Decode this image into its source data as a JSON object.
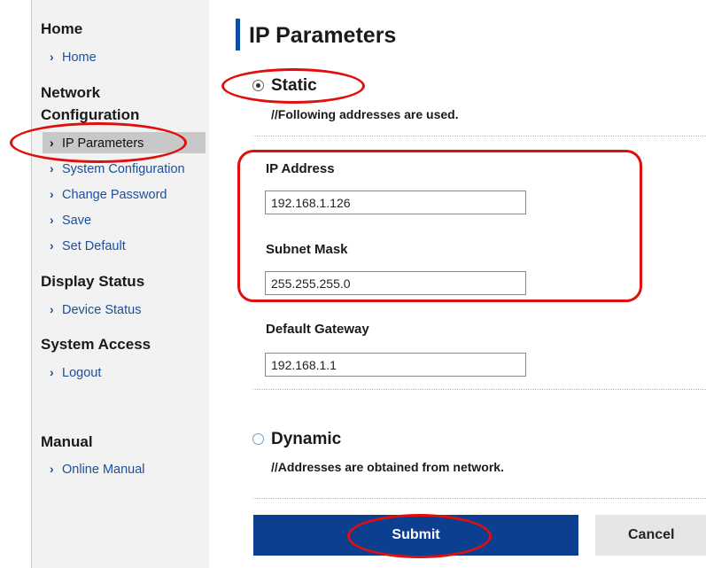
{
  "sidebar": {
    "sections": [
      {
        "title": "Home",
        "items": [
          {
            "label": "Home"
          }
        ]
      },
      {
        "title_line1": "Network",
        "title_line2": "Configuration",
        "items": [
          {
            "label": "IP Parameters",
            "active": true
          },
          {
            "label": "System Configuration"
          },
          {
            "label": "Change Password"
          },
          {
            "label": "Save"
          },
          {
            "label": "Set Default"
          }
        ]
      },
      {
        "title": "Display Status",
        "items": [
          {
            "label": "Device Status"
          }
        ]
      },
      {
        "title": "System Access",
        "items": [
          {
            "label": "Logout"
          }
        ]
      },
      {
        "title": "Manual",
        "items": [
          {
            "label": "Online Manual"
          }
        ]
      }
    ]
  },
  "main": {
    "title": "IP Parameters",
    "static_option": {
      "label": "Static",
      "selected": true,
      "description": "//Following addresses are used.",
      "fields": [
        {
          "label": "IP Address",
          "value": "192.168.1.126"
        },
        {
          "label": "Subnet Mask",
          "value": "255.255.255.0"
        },
        {
          "label": "Default Gateway",
          "value": "192.168.1.1"
        }
      ]
    },
    "dynamic_option": {
      "label": "Dynamic",
      "selected": false,
      "description": "//Addresses are obtained from network."
    },
    "submit_label": "Submit",
    "cancel_label": "Cancel"
  },
  "colors": {
    "accent": "#0d4ea6",
    "submit_bg": "#0d3f91",
    "link": "#1c4f9c",
    "annotation": "#e10e0e",
    "sidebar_bg": "#f2f2f2",
    "active_item_bg": "#c8c8c8"
  },
  "icons": {
    "nav_bullet": "chevron-right-icon"
  }
}
